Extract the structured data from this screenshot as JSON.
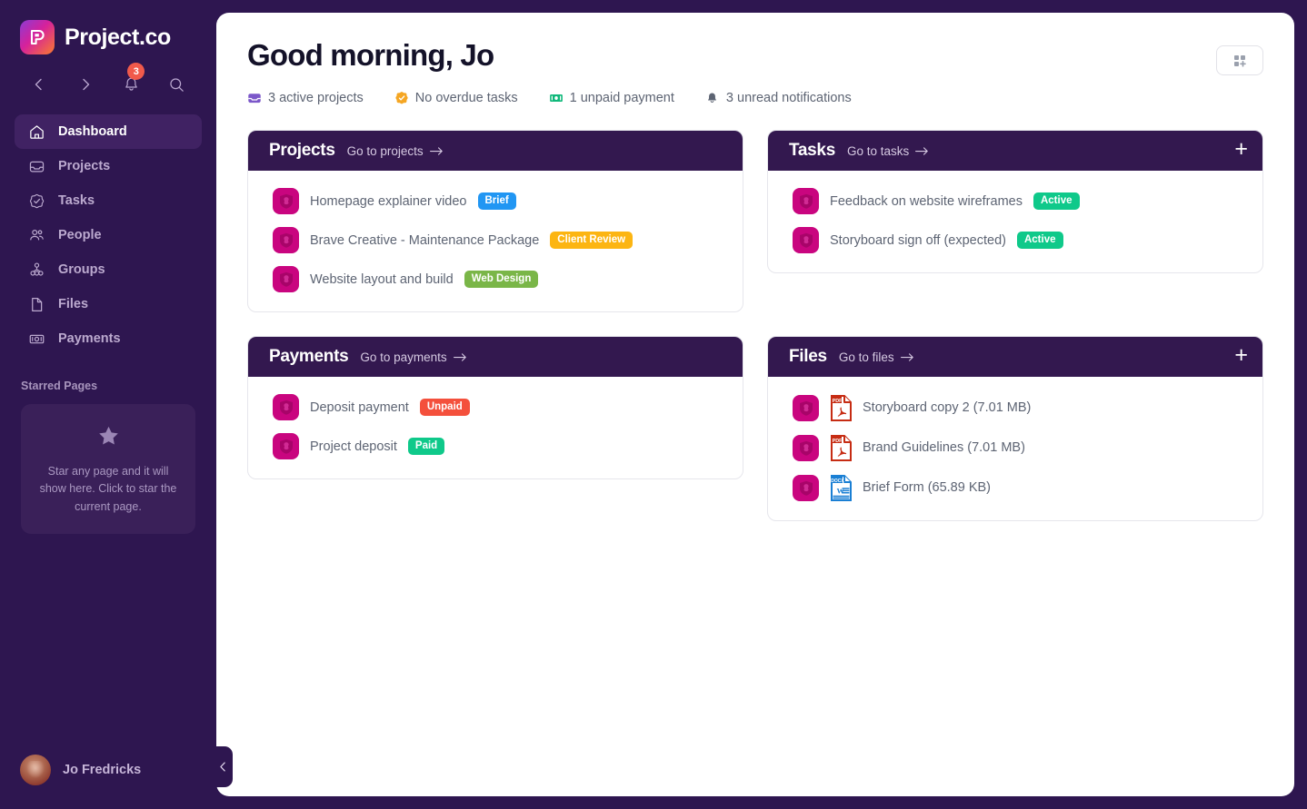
{
  "brand": {
    "name": "Project.co",
    "logo_icon": "project-co-logo-icon"
  },
  "sidebar": {
    "nav_icons": [
      {
        "name": "back-icon",
        "glyph": "‹"
      },
      {
        "name": "forward-icon",
        "glyph": "›"
      },
      {
        "name": "notifications-bell-icon",
        "badge": "3"
      },
      {
        "name": "search-icon"
      }
    ],
    "items": [
      {
        "label": "Dashboard",
        "icon": "home-icon",
        "active": true
      },
      {
        "label": "Projects",
        "icon": "inbox-icon",
        "active": false
      },
      {
        "label": "Tasks",
        "icon": "check-circle-icon",
        "active": false
      },
      {
        "label": "People",
        "icon": "people-icon",
        "active": false
      },
      {
        "label": "Groups",
        "icon": "groups-icon",
        "active": false
      },
      {
        "label": "Files",
        "icon": "file-icon",
        "active": false
      },
      {
        "label": "Payments",
        "icon": "banknote-icon",
        "active": false
      }
    ],
    "starred": {
      "title": "Starred Pages",
      "icon": "star-icon",
      "empty_text": "Star any page and it will show here. Click to star the current page."
    },
    "profile": {
      "name": "Jo Fredricks",
      "avatar": "user-avatar"
    },
    "collapse": {
      "icon": "chevron-left-icon"
    }
  },
  "header": {
    "greeting": "Good morning, Jo",
    "grid_button": {
      "name": "add-widget-grid-button"
    },
    "stats": [
      {
        "icon": "inbox-icon",
        "color": "#7b57c9",
        "text": "3 active projects"
      },
      {
        "icon": "check-badge-icon",
        "color": "#f5a623",
        "text": "No overdue tasks"
      },
      {
        "icon": "banknote-icon",
        "color": "#0fb87a",
        "text": "1 unpaid payment"
      },
      {
        "icon": "bell-icon",
        "color": "#5d6473",
        "text": "3 unread notifications"
      }
    ]
  },
  "cards": {
    "projects": {
      "title": "Projects",
      "link": "Go to projects",
      "has_plus": false,
      "rows": [
        {
          "label": "Homepage explainer video",
          "badge": "Brief",
          "badge_color": "#2196f3"
        },
        {
          "label": "Brave Creative - Maintenance Package",
          "badge": "Client Review",
          "badge_color": "#fcb512"
        },
        {
          "label": "Website layout and build",
          "badge": "Web Design",
          "badge_color": "#7ab648"
        }
      ]
    },
    "tasks": {
      "title": "Tasks",
      "link": "Go to tasks",
      "has_plus": true,
      "plus_label": "+",
      "rows": [
        {
          "label": "Feedback on website wireframes",
          "badge": "Active",
          "badge_color": "#0fc98a"
        },
        {
          "label": "Storyboard sign off (expected)",
          "badge": "Active",
          "badge_color": "#0fc98a"
        }
      ]
    },
    "payments": {
      "title": "Payments",
      "link": "Go to payments",
      "has_plus": false,
      "rows": [
        {
          "label": "Deposit payment",
          "badge": "Unpaid",
          "badge_color": "#f4503c"
        },
        {
          "label": "Project deposit",
          "badge": "Paid",
          "badge_color": "#0fc98a"
        }
      ]
    },
    "files": {
      "title": "Files",
      "link": "Go to files",
      "has_plus": true,
      "plus_label": "+",
      "rows": [
        {
          "label": "Storyboard copy 2 (7.01 MB)",
          "filetype": "PDF",
          "file_icon": "pdf-file-icon"
        },
        {
          "label": "Brand Guidelines (7.01 MB)",
          "filetype": "PDF",
          "file_icon": "pdf-file-icon"
        },
        {
          "label": "Brief Form (65.89 KB)",
          "filetype": "DOCX",
          "file_icon": "docx-file-icon"
        }
      ]
    }
  },
  "colors": {
    "sidebar_bg": "#2e1650",
    "card_header_bg": "#33184f",
    "accent_magenta": "#c9057f",
    "badge_blue": "#2196f3",
    "badge_amber": "#fcb512",
    "badge_green": "#7ab648",
    "badge_teal": "#0fc98a",
    "badge_red": "#f4503c"
  }
}
